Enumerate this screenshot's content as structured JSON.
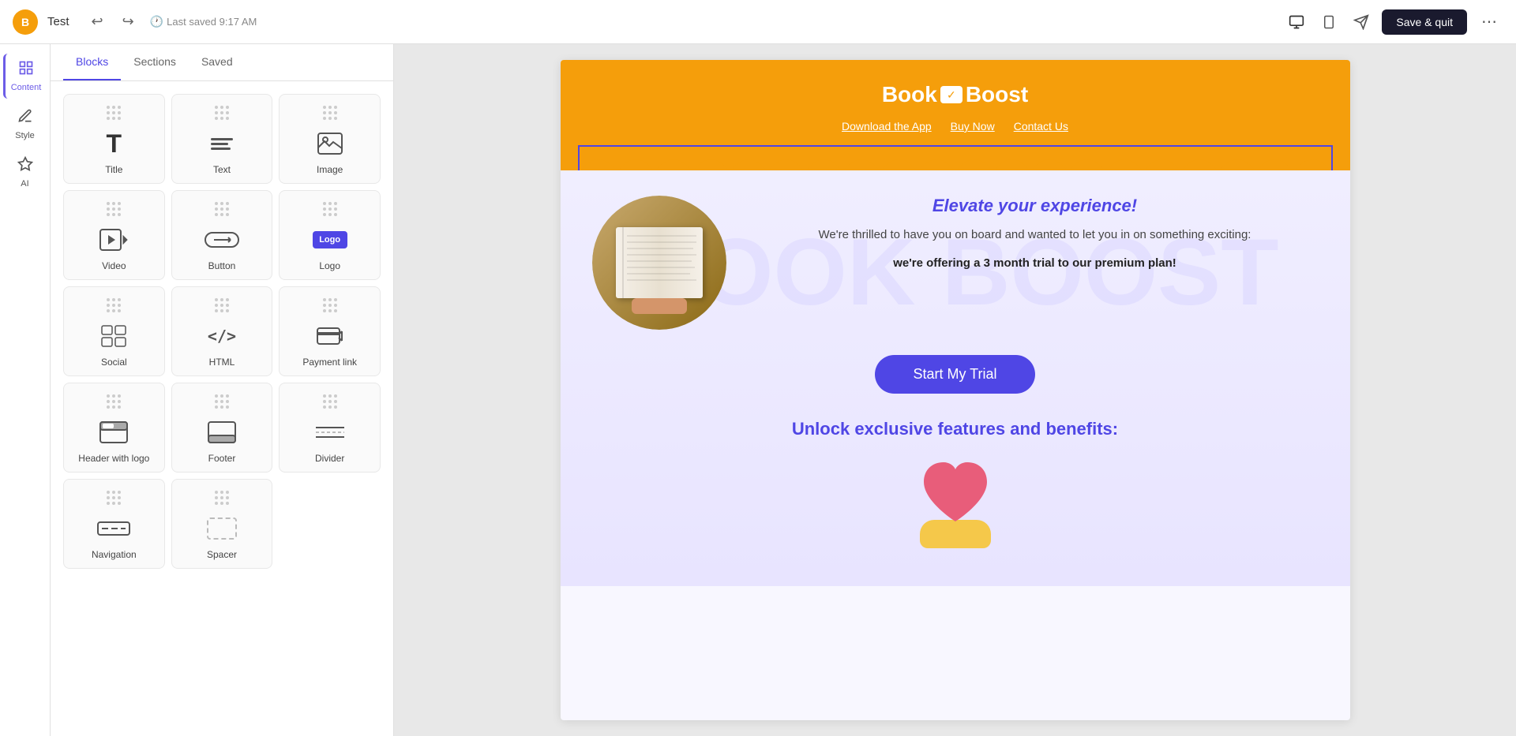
{
  "app": {
    "title": "Test",
    "logo_letter": "B",
    "saved_text": "Last saved 9:17 AM",
    "save_quit_label": "Save & quit"
  },
  "topbar": {
    "undo_icon": "↩",
    "redo_icon": "↪",
    "clock_icon": "🕐",
    "monitor_icon": "🖥",
    "tablet_icon": "📱",
    "send_icon": "➤",
    "more_icon": "⋯"
  },
  "sidebar": {
    "items": [
      {
        "id": "content",
        "label": "Content",
        "icon": "⊞",
        "active": true
      },
      {
        "id": "style",
        "label": "Style",
        "icon": "✏"
      },
      {
        "id": "ai",
        "label": "AI",
        "icon": "✦"
      }
    ]
  },
  "blocks_panel": {
    "tabs": [
      {
        "id": "blocks",
        "label": "Blocks",
        "active": true
      },
      {
        "id": "sections",
        "label": "Sections",
        "active": false
      },
      {
        "id": "saved",
        "label": "Saved",
        "active": false
      }
    ],
    "blocks": [
      {
        "id": "title",
        "label": "Title"
      },
      {
        "id": "text",
        "label": "Text"
      },
      {
        "id": "image",
        "label": "Image"
      },
      {
        "id": "video",
        "label": "Video"
      },
      {
        "id": "button",
        "label": "Button"
      },
      {
        "id": "logo",
        "label": "Logo"
      },
      {
        "id": "social",
        "label": "Social"
      },
      {
        "id": "html",
        "label": "HTML"
      },
      {
        "id": "payment-link",
        "label": "Payment link"
      },
      {
        "id": "header-with-logo",
        "label": "Header with logo"
      },
      {
        "id": "footer",
        "label": "Footer"
      },
      {
        "id": "divider",
        "label": "Divider"
      },
      {
        "id": "navigation",
        "label": "Navigation"
      },
      {
        "id": "spacer",
        "label": "Spacer"
      }
    ]
  },
  "email": {
    "header": {
      "logo_book": "Book",
      "logo_boost": "Boost",
      "nav_links": [
        "Download the App",
        "Buy Now",
        "Contact Us"
      ]
    },
    "body": {
      "headline": "Elevate your experience!",
      "paragraph1": "We're thrilled to have you on board and wanted to let you in on something exciting:",
      "paragraph2": "we're offering a 3 month trial to our premium plan!",
      "cta_label": "Start My Trial",
      "unlock_headline": "Unlock exclusive features and benefits:"
    }
  }
}
